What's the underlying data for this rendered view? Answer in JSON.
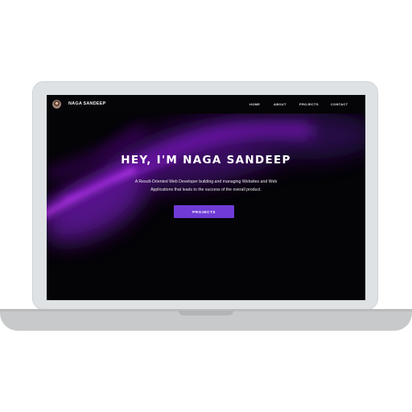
{
  "nav": {
    "brand": "NAGA SANDEEP",
    "links": [
      {
        "label": "HOME"
      },
      {
        "label": "ABOUT"
      },
      {
        "label": "PROJECTS"
      },
      {
        "label": "CONTACT"
      }
    ]
  },
  "hero": {
    "title": "HEY, I'M NAGA SANDEEP",
    "subtitle_line1": "A Result-Oriented Web Developer building and managing Websites and Web",
    "subtitle_line2": "Applications that leads to the success of the overall product.",
    "cta_label": "PROJECTS"
  },
  "colors": {
    "accent": "#6f3bd6",
    "screen_background": "#040306",
    "glow": "#9b22e0",
    "laptop_body": "#dfe2e5",
    "laptop_base": "#c7c9cb"
  },
  "icons": {
    "avatar": "profile-avatar"
  }
}
